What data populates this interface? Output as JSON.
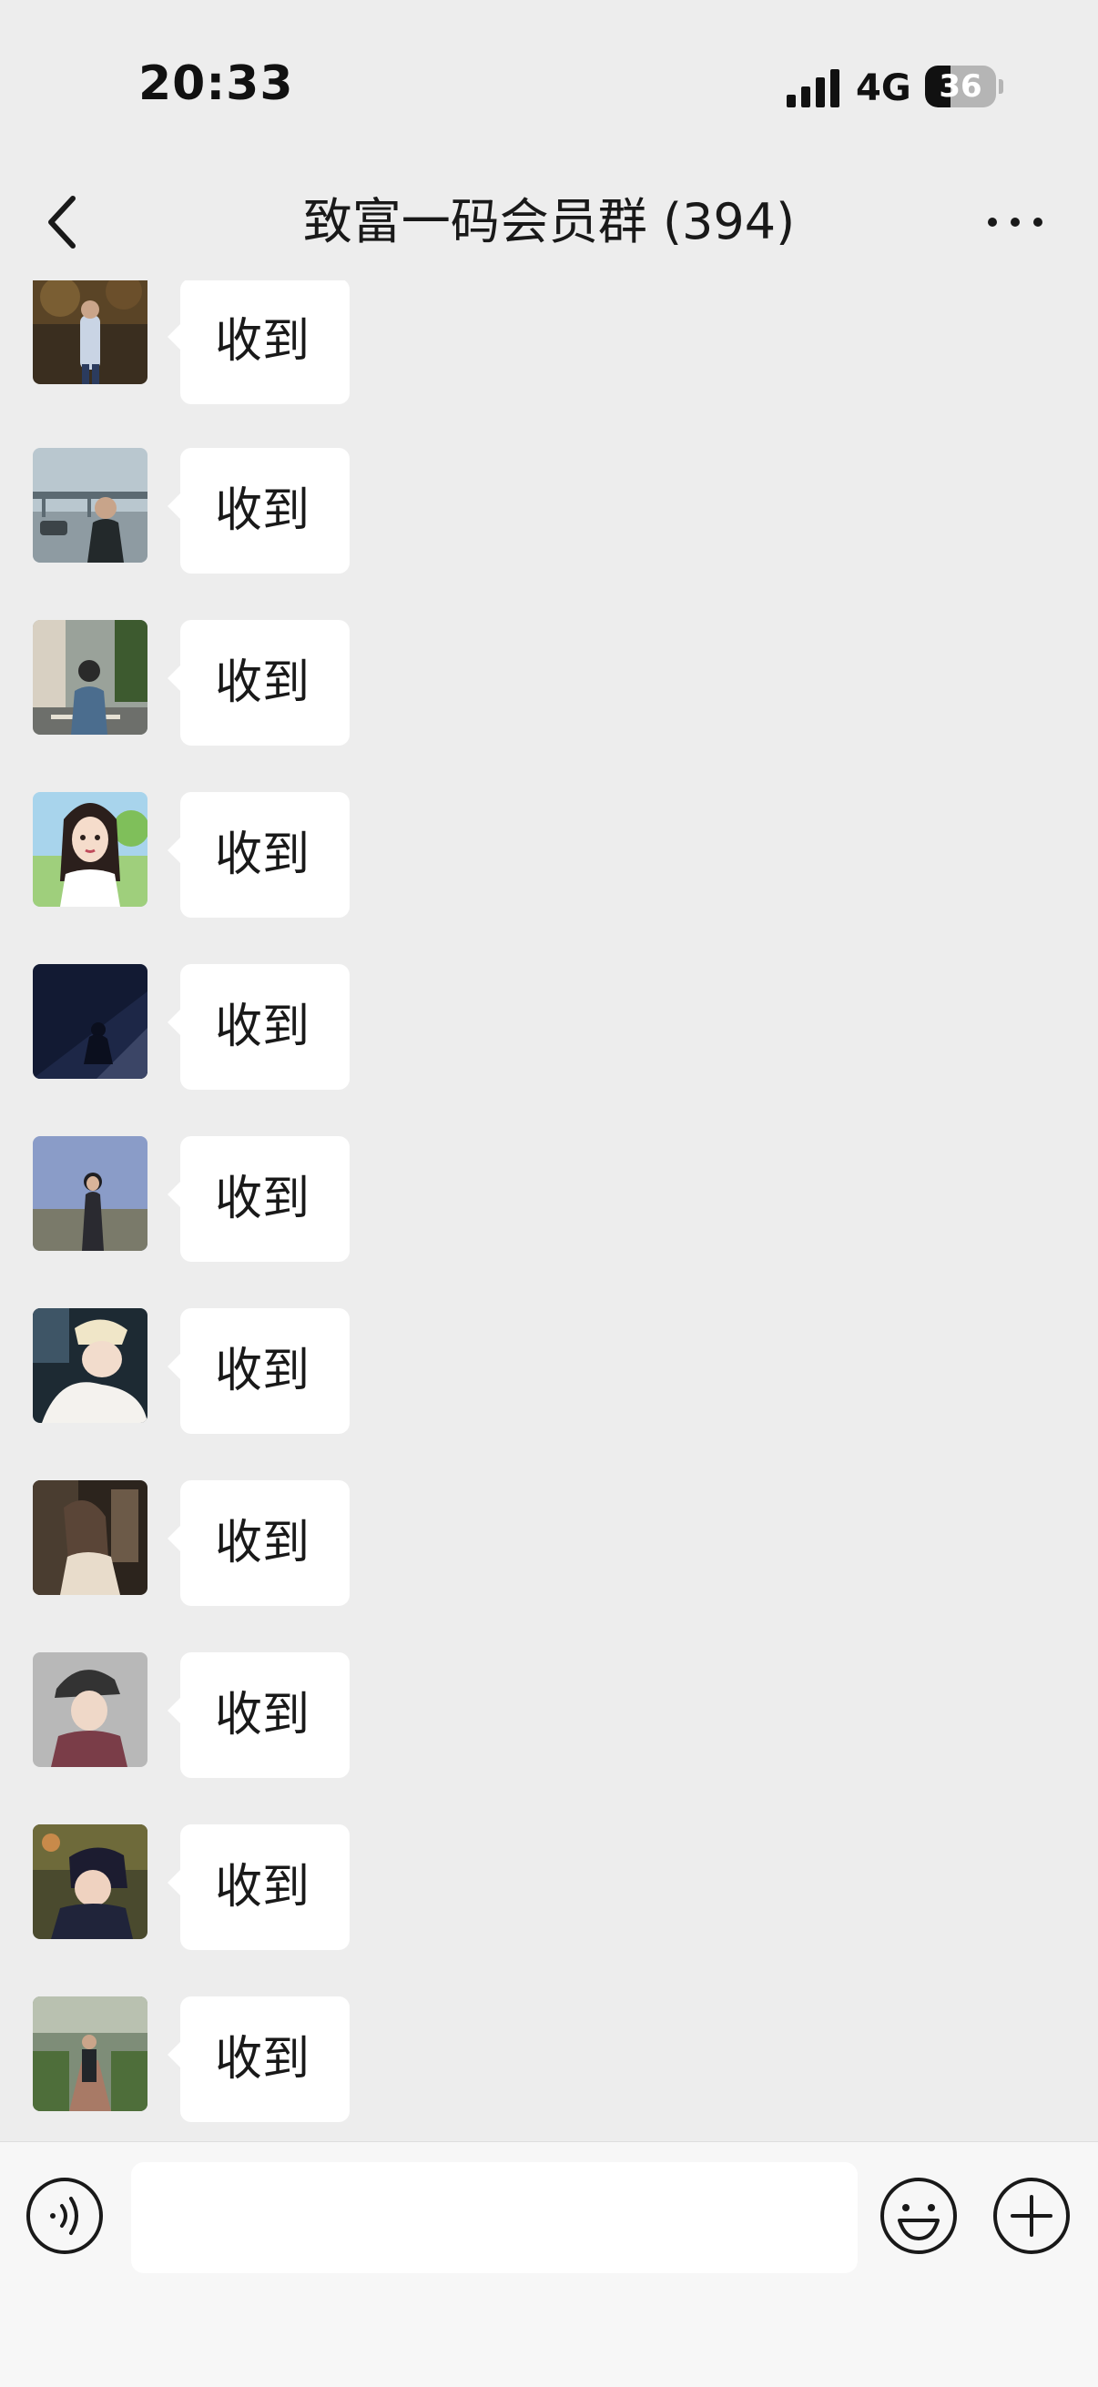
{
  "status_bar": {
    "time": "20:33",
    "network": "4G",
    "battery_level": "36",
    "battery_fraction": 0.36
  },
  "nav": {
    "title": "致富一码会员群 (394)",
    "back_icon": "chevron-left-icon",
    "more_icon": "ellipsis-icon"
  },
  "messages": [
    {
      "text": "收到",
      "avatar": "avatar-man-standing-forest"
    },
    {
      "text": "收到",
      "avatar": "avatar-woman-bridge"
    },
    {
      "text": "收到",
      "avatar": "avatar-man-street"
    },
    {
      "text": "收到",
      "avatar": "avatar-cartoon-girl"
    },
    {
      "text": "收到",
      "avatar": "avatar-dark-night"
    },
    {
      "text": "收到",
      "avatar": "avatar-woman-dusk"
    },
    {
      "text": "收到",
      "avatar": "avatar-woman-cap-car"
    },
    {
      "text": "收到",
      "avatar": "avatar-woman-mirror"
    },
    {
      "text": "收到",
      "avatar": "avatar-woman-hat"
    },
    {
      "text": "收到",
      "avatar": "avatar-woman-hand-face"
    },
    {
      "text": "收到",
      "avatar": "avatar-man-garden-path"
    }
  ],
  "input_bar": {
    "value": "",
    "voice_icon": "voice-icon",
    "emoji_icon": "emoji-icon",
    "plus_icon": "plus-icon"
  }
}
